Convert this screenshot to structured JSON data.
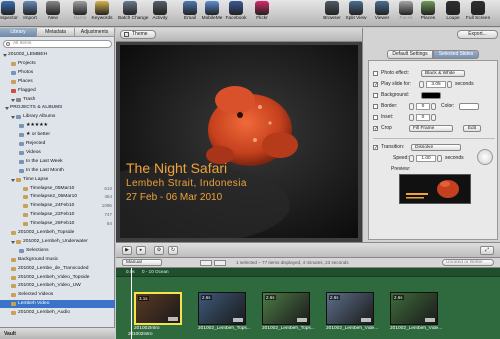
{
  "toolbar": {
    "items": [
      {
        "label": "Inspector",
        "icon": "inspector-icon",
        "color": "#3b6fb5"
      },
      {
        "label": "Import",
        "icon": "import-icon",
        "color": "#6a8bb8"
      },
      {
        "label": "New",
        "icon": "new-icon",
        "color": "#888888"
      },
      {
        "label": "Name",
        "icon": "name-icon",
        "color": "#a0a0a0",
        "dim": true
      },
      {
        "label": "Keywords",
        "icon": "keywords-icon",
        "color": "#d6b24a"
      },
      {
        "label": "Batch Change",
        "icon": "batch-change-icon",
        "color": "#6b7a8c"
      },
      {
        "label": "Activity",
        "icon": "activity-icon",
        "color": "#55606b"
      },
      {
        "label": "Email",
        "icon": "email-icon",
        "color": "#4e79b5"
      },
      {
        "label": "MobileMe",
        "icon": "mobileme-icon",
        "color": "#5b8fd4"
      },
      {
        "label": "Facebook",
        "icon": "facebook-icon",
        "color": "#3b5998"
      },
      {
        "label": "Flickr",
        "icon": "flickr-icon",
        "color": "#d9286b"
      },
      {
        "label": "Browser",
        "icon": "browser-icon",
        "color": "#505a66"
      },
      {
        "label": "Split View",
        "icon": "split-view-icon",
        "color": "#4a6f92"
      },
      {
        "label": "Viewer",
        "icon": "viewer-icon",
        "color": "#4a6f92"
      },
      {
        "label": "Faces",
        "icon": "faces-icon",
        "color": "#a5a5a5",
        "dim": true
      },
      {
        "label": "Places",
        "icon": "places-icon",
        "color": "#6f9b57"
      },
      {
        "label": "Loupe",
        "icon": "loupe-icon",
        "color": "#2f2f2f"
      },
      {
        "label": "Full Screen",
        "icon": "full-screen-icon",
        "color": "#2f2f2f"
      }
    ]
  },
  "left_panel": {
    "tabs": [
      "Library",
      "Metadata",
      "Adjustments"
    ],
    "active_tab": "Library",
    "search_placeholder": "All Items",
    "rows": [
      {
        "text": "201002_LEMBEH",
        "indent": 0,
        "kind": "plain",
        "count": "",
        "color": ""
      },
      {
        "text": "Projects",
        "indent": 8,
        "kind": "item",
        "count": "",
        "color": "#c7a15a"
      },
      {
        "text": "Photos",
        "indent": 8,
        "kind": "item",
        "count": "",
        "color": "#7a94b5"
      },
      {
        "text": "Places",
        "indent": 8,
        "kind": "item",
        "count": "",
        "color": "#c7a15a"
      },
      {
        "text": "Flagged",
        "indent": 8,
        "kind": "item",
        "count": "",
        "color": "#d24a3c"
      },
      {
        "text": "Trash",
        "indent": 8,
        "kind": "tri",
        "count": "",
        "color": "#888888"
      },
      {
        "text": "PROJECTS & ALBUMS",
        "indent": 2,
        "kind": "hdr",
        "count": "",
        "color": ""
      },
      {
        "text": "Library Albums",
        "indent": 8,
        "kind": "tri",
        "count": "",
        "color": "#7a94b5"
      },
      {
        "text": "★★★★★",
        "indent": 16,
        "kind": "item",
        "count": "",
        "color": "#7a94b5"
      },
      {
        "text": "★ or better",
        "indent": 16,
        "kind": "item",
        "count": "",
        "color": "#7a94b5"
      },
      {
        "text": "Rejected",
        "indent": 16,
        "kind": "item",
        "count": "",
        "color": "#7a94b5"
      },
      {
        "text": "Videos",
        "indent": 16,
        "kind": "item",
        "count": "",
        "color": "#7a94b5"
      },
      {
        "text": "In the Last Week",
        "indent": 16,
        "kind": "item",
        "count": "",
        "color": "#7a94b5"
      },
      {
        "text": "In the Last Month",
        "indent": 16,
        "kind": "item",
        "count": "",
        "color": "#7a94b5"
      },
      {
        "text": "Time Lapse",
        "indent": 8,
        "kind": "tri",
        "count": "",
        "color": "#c7a15a"
      },
      {
        "text": "Timelapse_05Mar10",
        "indent": 20,
        "kind": "item",
        "count": "610",
        "color": "#c7a15a"
      },
      {
        "text": "Timelapse2_05Mar10",
        "indent": 20,
        "kind": "item",
        "count": "454",
        "color": "#c7a15a"
      },
      {
        "text": "Timelapse_24Feb10",
        "indent": 20,
        "kind": "item",
        "count": "1095",
        "color": "#c7a15a"
      },
      {
        "text": "Timelapse_22Feb10",
        "indent": 20,
        "kind": "item",
        "count": "747",
        "color": "#c7a15a"
      },
      {
        "text": "Timelapse_26Feb10",
        "indent": 20,
        "kind": "item",
        "count": "84",
        "color": "#c7a15a"
      },
      {
        "text": "201002_Lembeh_Topside",
        "indent": 8,
        "kind": "item",
        "count": "",
        "color": "#c7a15a"
      },
      {
        "text": "201002_Lembeh_Underwater",
        "indent": 8,
        "kind": "tri",
        "count": "",
        "color": "#c7a15a"
      },
      {
        "text": "Selections",
        "indent": 16,
        "kind": "item",
        "count": "",
        "color": "#7a94b5"
      },
      {
        "text": "Background music",
        "indent": 8,
        "kind": "item",
        "count": "",
        "color": "#c7a15a"
      },
      {
        "text": "201002_Lembe_de_Transcoded",
        "indent": 8,
        "kind": "item",
        "count": "",
        "color": "#c7a15a"
      },
      {
        "text": "201002_Lembeh_Video_Topside",
        "indent": 8,
        "kind": "item",
        "count": "",
        "color": "#c7a15a"
      },
      {
        "text": "201002_Lembeh_Video_UW",
        "indent": 8,
        "kind": "item",
        "count": "",
        "color": "#c7a15a"
      },
      {
        "text": "Selected Videos",
        "indent": 8,
        "kind": "item",
        "count": "",
        "color": "#c7a15a"
      },
      {
        "text": "Lembeh Video",
        "indent": 8,
        "kind": "sel",
        "count": "",
        "color": "#c7a15a"
      },
      {
        "text": "201002_Lembeh_Audio",
        "indent": 8,
        "kind": "item",
        "count": "",
        "color": "#c7a15a"
      }
    ],
    "vault_label": "Vault"
  },
  "viewer": {
    "theme_button": "Theme",
    "slide_title": "The Night Safari",
    "slide_subtitle": "Lembeh Strait, Indonesia",
    "slide_dates": "27 Feb - 06 Mar 2010",
    "title_color": "#f0a33a"
  },
  "inspector": {
    "export_button": "Export...",
    "tabs": [
      "Default Settings",
      "Selected Slides"
    ],
    "active_tab": "Selected Slides",
    "photo_effect_label": "Photo effect:",
    "photo_effect_value": "Black & White",
    "play_slide_label": "Play slide for:",
    "play_slide_value": "3.05",
    "play_slide_unit": "seconds",
    "background_label": "Background:",
    "border_label": "Border:",
    "border_value": "0",
    "color_label": "Color:",
    "inset_label": "Inset:",
    "inset_value": "0",
    "crop_label": "Crop",
    "crop_value": "Fill Frame",
    "edit_button": "Edit",
    "transition_label": "Transition:",
    "transition_value": "Dissolve",
    "speed_label": "Speed:",
    "speed_value": "1.00",
    "speed_unit": "seconds",
    "preview_label": "Preview:"
  },
  "controls": {
    "manual_select": "Manual",
    "status_text": "1 selected – 77 items displayed, 4 minutes, 23 seconds",
    "rating_filter": "Unrated or Better"
  },
  "timeline": {
    "ruler_label": "0.0s",
    "track_label": "0 - 10 Ocean",
    "clips": [
      {
        "name": "201002Intro",
        "duration": "3.1s",
        "color": "#5a3a22",
        "selected": true
      },
      {
        "name": "201002_Lembeh_Tops...",
        "duration": "2.6s",
        "color": "#3d5a7a",
        "selected": false
      },
      {
        "name": "201002_Lembeh_Tops...",
        "duration": "2.6s",
        "color": "#4d7a45",
        "selected": false
      },
      {
        "name": "201002_Lembeh_Vide...",
        "duration": "2.6s",
        "color": "#5d6f8a",
        "selected": false
      },
      {
        "name": "201002_Lembeh_Vide...",
        "duration": "2.6s",
        "color": "#3f6b3b",
        "selected": false
      }
    ],
    "bottom_label": "201002Intro"
  }
}
